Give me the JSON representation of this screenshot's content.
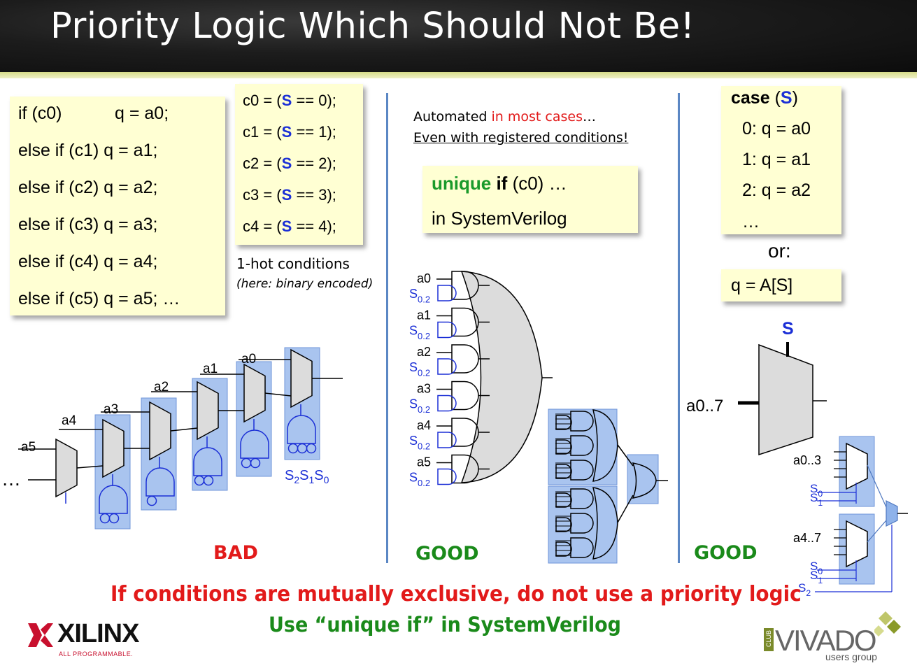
{
  "title": "Priority Logic Which Should Not Be!",
  "if_chain": [
    {
      "cond": "if (c0)",
      "assign": "q = a0;"
    },
    {
      "cond": "else if (c1)",
      "assign": "q = a1;"
    },
    {
      "cond": "else if (c2)",
      "assign": "q = a2;"
    },
    {
      "cond": "else if (c3)",
      "assign": "q = a3;"
    },
    {
      "cond": "else if (c4)",
      "assign": "q = a4;"
    },
    {
      "cond": "else if (c5)",
      "assign": "q = a5; …"
    }
  ],
  "conditions": [
    {
      "pre": "c0 = (",
      "sig": "S",
      "post": " == 0);"
    },
    {
      "pre": "c1 = (",
      "sig": "S",
      "post": " == 1);"
    },
    {
      "pre": "c2 = (",
      "sig": "S",
      "post": " == 2);"
    },
    {
      "pre": "c3 = (",
      "sig": "S",
      "post": " == 3);"
    },
    {
      "pre": "c4 = (",
      "sig": "S",
      "post": " == 4);"
    }
  ],
  "onehot": {
    "line1": "1-hot conditions",
    "line2": "(here: binary encoded)"
  },
  "automated": {
    "pre": "Automated ",
    "red": "in most cases",
    "post": "…",
    "line2": "Even with registered conditions!"
  },
  "unique_box": {
    "kw1": "unique",
    "kw2": "if",
    "rest": " (c0) …",
    "line2": "in SystemVerilog"
  },
  "case_box": {
    "kw": "case",
    "open": " (",
    "sig": "S",
    "close": ")",
    "items": [
      "0: q = a0",
      "1: q = a1",
      "2: q = a2",
      "…"
    ]
  },
  "or_label": "or:",
  "array_box": "q = A[S]",
  "labels": {
    "bad": "BAD",
    "good1": "GOOD",
    "good2": "GOOD"
  },
  "bottom": {
    "line1": "If conditions are mutually exclusive, do not use a priority logic",
    "line2": "Use “unique if” in SystemVerilog"
  },
  "footer": {
    "xilinx": "XILINX",
    "xilinx_sub": "ALL PROGRAMMABLE.",
    "vivado": "VIVADO",
    "vivado_club": "CLUB",
    "vivado_sub": "users group"
  },
  "diagram_bad": {
    "inputs": [
      "a5",
      "a4",
      "a3",
      "a2",
      "a1",
      "a0"
    ],
    "ellipsis": "…",
    "select": [
      "S",
      "2",
      "S",
      "1",
      "S",
      "0"
    ]
  },
  "diagram_and": {
    "inputs": [
      "a0",
      "a1",
      "a2",
      "a3",
      "a4",
      "a5"
    ],
    "sel": "S",
    "sel_sub": "0.2"
  },
  "diagram_mux": {
    "sel": "S",
    "in": "a0..7",
    "lo": "a0..3",
    "hi": "a4..7",
    "s0": "S",
    "s0_sub": "0",
    "s1": "S",
    "s1_sub": "1",
    "s2": "S",
    "s2_sub": "2"
  },
  "colors": {
    "accent": "#1b2fd6",
    "good": "#1a8a1a",
    "bad": "#e21a1a",
    "box": "#ffffd3",
    "sep": "#5b87c4",
    "shade": "#a9c4ef"
  }
}
